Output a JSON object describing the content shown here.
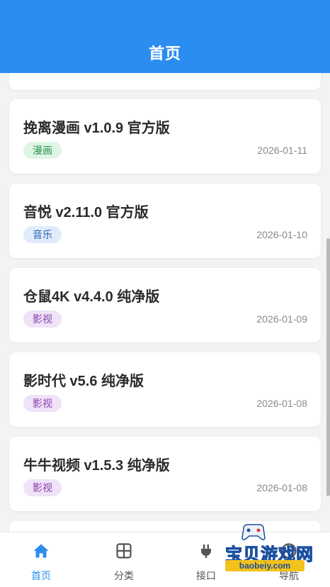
{
  "header": {
    "title": "首页"
  },
  "colors": {
    "primary": "#2b8df0",
    "tab_inactive": "#555555",
    "background": "#f2f3f5"
  },
  "items": [
    {
      "title": "挽离漫画 v1.0.9 官方版",
      "tag": "漫画",
      "date": "2026-01-11"
    },
    {
      "title": "音悦 v2.11.0 官方版",
      "tag": "音乐",
      "date": "2026-01-10"
    },
    {
      "title": "仓鼠4K v4.4.0 纯净版",
      "tag": "影视",
      "date": "2026-01-09"
    },
    {
      "title": "影时代 v5.6 纯净版",
      "tag": "影视",
      "date": "2026-01-08"
    },
    {
      "title": "牛牛视频 v1.5.3 纯净版",
      "tag": "影视",
      "date": "2026-01-08"
    }
  ],
  "tabbar": [
    {
      "label": "首页",
      "icon": "home-icon",
      "active": true
    },
    {
      "label": "分类",
      "icon": "grid-icon",
      "active": false
    },
    {
      "label": "接口",
      "icon": "plug-icon",
      "active": false
    },
    {
      "label": "导航",
      "icon": "compass-icon",
      "active": false
    }
  ],
  "watermark": {
    "text": "宝贝游戏网",
    "url": "baobeiy.com"
  }
}
